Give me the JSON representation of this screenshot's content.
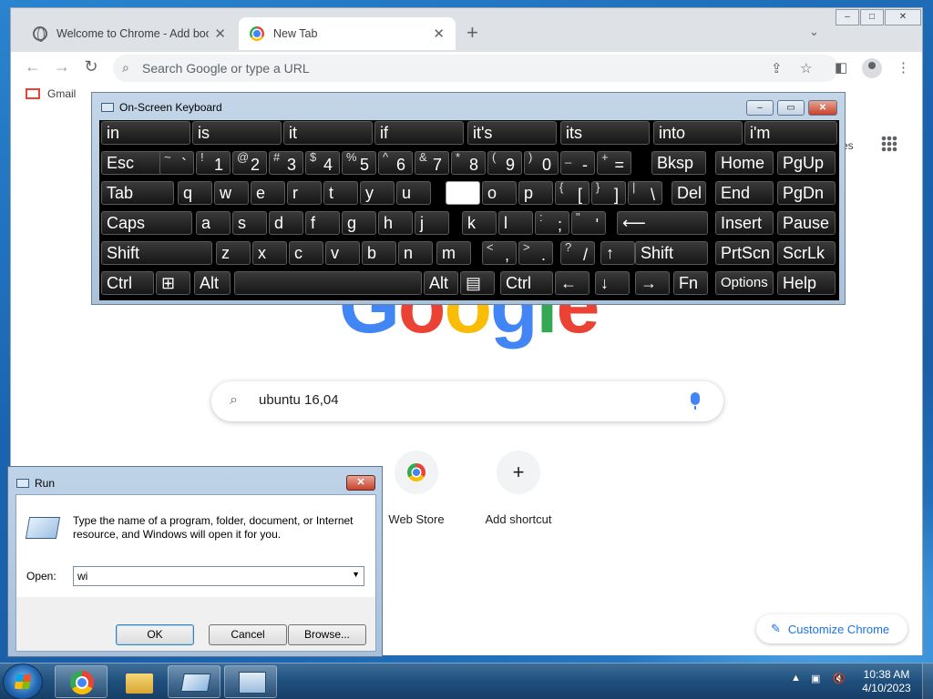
{
  "chrome": {
    "tabs": [
      {
        "label": "Welcome to Chrome - Add book",
        "close": "✕"
      },
      {
        "label": "New Tab",
        "close": "✕"
      }
    ],
    "new_tab": "+",
    "tab_search": "⌄",
    "window_buttons": {
      "minimize": "–",
      "maximize": "□",
      "close": "✕"
    },
    "nav": {
      "back": "←",
      "forward": "→",
      "reload": "↻"
    },
    "omnibox_placeholder": "Search Google or type a URL",
    "bookmarks": [
      {
        "label": "Gmail"
      }
    ],
    "apps_label": "es",
    "logo_letters": [
      "G",
      "o",
      "o",
      "g",
      "l",
      "e"
    ],
    "search_value": "ubuntu 16,04",
    "shortcuts": [
      {
        "label": "Web Store"
      },
      {
        "label": "Add shortcut",
        "icon": "+"
      }
    ],
    "customize_label": "Customize Chrome"
  },
  "osk": {
    "title": "On-Screen Keyboard",
    "suggestions": [
      "in",
      "is",
      "it",
      "if",
      "it's",
      "its",
      "into",
      "i'm"
    ],
    "row1": [
      {
        "label": "Esc"
      },
      {
        "sup": "~",
        "main": "`"
      },
      {
        "sup": "!",
        "main": "1"
      },
      {
        "sup": "@",
        "main": "2"
      },
      {
        "sup": "#",
        "main": "3"
      },
      {
        "sup": "$",
        "main": "4"
      },
      {
        "sup": "%",
        "main": "5"
      },
      {
        "sup": "^",
        "main": "6"
      },
      {
        "sup": "&",
        "main": "7"
      },
      {
        "sup": "*",
        "main": "8"
      },
      {
        "sup": "(",
        "main": "9"
      },
      {
        "sup": ")",
        "main": "0"
      },
      {
        "sup": "_",
        "main": "-"
      },
      {
        "sup": "+",
        "main": "="
      },
      {
        "label": "Bksp"
      },
      {
        "label": "Home"
      },
      {
        "label": "PgUp"
      }
    ],
    "row2": [
      {
        "label": "Tab"
      },
      {
        "label": "q"
      },
      {
        "label": "w"
      },
      {
        "label": "e"
      },
      {
        "label": "r"
      },
      {
        "label": "t"
      },
      {
        "label": "y"
      },
      {
        "label": "u"
      },
      {
        "label": ""
      },
      {
        "label": "o"
      },
      {
        "label": "p"
      },
      {
        "sup": "{",
        "main": "["
      },
      {
        "sup": "}",
        "main": "]"
      },
      {
        "sup": "|",
        "main": "\\"
      },
      {
        "label": "Del"
      },
      {
        "label": "End"
      },
      {
        "label": "PgDn"
      }
    ],
    "row3": [
      {
        "label": "Caps"
      },
      {
        "label": "a"
      },
      {
        "label": "s"
      },
      {
        "label": "d"
      },
      {
        "label": "f"
      },
      {
        "label": "g"
      },
      {
        "label": "h"
      },
      {
        "label": "j"
      },
      {
        "label": "k"
      },
      {
        "label": "l"
      },
      {
        "sup": ":",
        "main": ";"
      },
      {
        "sup": "\"",
        "main": "'"
      },
      {
        "label": "⟵"
      },
      {
        "label": "Insert"
      },
      {
        "label": "Pause"
      }
    ],
    "row4": [
      {
        "label": "Shift"
      },
      {
        "label": "z"
      },
      {
        "label": "x"
      },
      {
        "label": "c"
      },
      {
        "label": "v"
      },
      {
        "label": "b"
      },
      {
        "label": "n"
      },
      {
        "label": "m"
      },
      {
        "sup": "<",
        "main": ","
      },
      {
        "sup": ">",
        "main": "."
      },
      {
        "sup": "?",
        "main": "/"
      },
      {
        "label": "↑"
      },
      {
        "label": "Shift"
      },
      {
        "label": "PrtScn"
      },
      {
        "label": "ScrLk"
      }
    ],
    "row5": [
      {
        "label": "Ctrl"
      },
      {
        "label": "⊞"
      },
      {
        "label": "Alt"
      },
      {
        "label": ""
      },
      {
        "label": "Alt"
      },
      {
        "label": "▤"
      },
      {
        "label": "Ctrl"
      },
      {
        "label": "←"
      },
      {
        "label": "↓"
      },
      {
        "label": "→"
      },
      {
        "label": "Fn"
      },
      {
        "label": "Options"
      },
      {
        "label": "Help"
      }
    ]
  },
  "run": {
    "title": "Run",
    "close": "✕",
    "description": "Type the name of a program, folder, document, or Internet resource, and Windows will open it for you.",
    "open_label": "Open:",
    "open_value": "wi",
    "ok": "OK",
    "cancel": "Cancel",
    "browse": "Browse..."
  },
  "taskbar": {
    "tray": "▲",
    "time": "10:38 AM",
    "date": "4/10/2023"
  }
}
